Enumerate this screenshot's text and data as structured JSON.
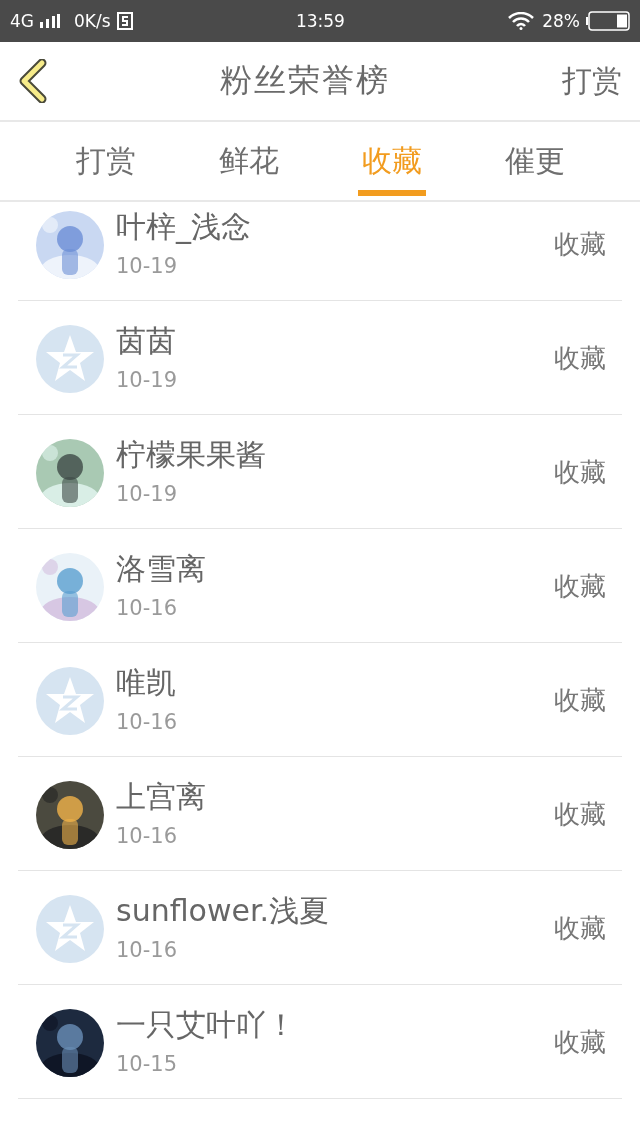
{
  "status_bar": {
    "network": "4G",
    "speed": "0K/s",
    "time": "13:59",
    "battery": "28%"
  },
  "header": {
    "title": "粉丝荣誉榜",
    "action": "打赏"
  },
  "tabs": [
    {
      "label": "打赏",
      "selected": false
    },
    {
      "label": "鲜花",
      "selected": false
    },
    {
      "label": "收藏",
      "selected": true
    },
    {
      "label": "催更",
      "selected": false
    }
  ],
  "fans": [
    {
      "name": "叶梓_浅念",
      "date": "10-19",
      "action": "收藏",
      "kind": "picture"
    },
    {
      "name": "茵茵",
      "date": "10-19",
      "action": "收藏",
      "kind": "default"
    },
    {
      "name": "柠檬果果酱",
      "date": "10-19",
      "action": "收藏",
      "kind": "picture"
    },
    {
      "name": "洛雪离",
      "date": "10-16",
      "action": "收藏",
      "kind": "picture"
    },
    {
      "name": "唯凯",
      "date": "10-16",
      "action": "收藏",
      "kind": "default"
    },
    {
      "name": "上宫离",
      "date": "10-16",
      "action": "收藏",
      "kind": "picture"
    },
    {
      "name": "sunflower.浅夏",
      "date": "10-16",
      "action": "收藏",
      "kind": "default"
    },
    {
      "name": "一只艾叶吖！",
      "date": "10-15",
      "action": "收藏",
      "kind": "picture"
    }
  ]
}
